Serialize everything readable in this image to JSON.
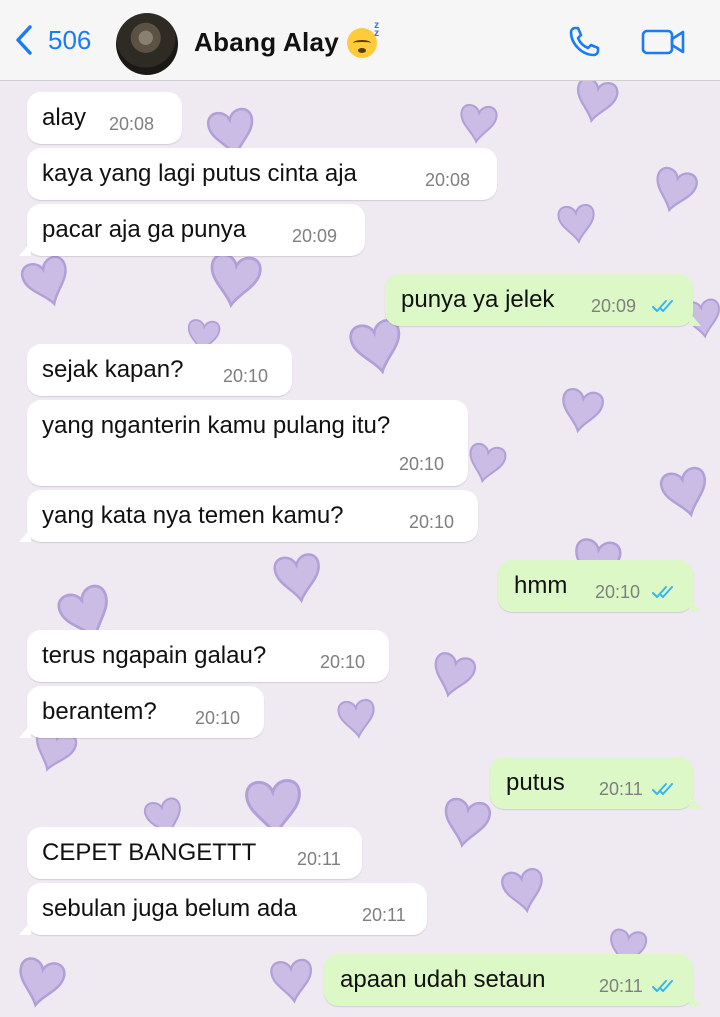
{
  "header": {
    "back_count": "506",
    "contact_name": "Abang Alay",
    "status_emoji": "sleeping-face",
    "call_icon": "phone-icon",
    "video_icon": "video-camera-icon"
  },
  "colors": {
    "accent": "#1a7cf4",
    "incoming_bubble": "#ffffff",
    "outgoing_bubble": "#dcf8c6",
    "read_ticks": "#34b7f1",
    "wallpaper_heart": "#b9a6dd"
  },
  "messages": [
    {
      "dir": "in",
      "text": "alay",
      "time": "20:08"
    },
    {
      "dir": "in",
      "text": "kaya yang lagi putus cinta aja",
      "time": "20:08"
    },
    {
      "dir": "in",
      "text": "pacar aja ga punya",
      "time": "20:09"
    },
    {
      "dir": "out",
      "text": "punya ya jelek",
      "time": "20:09",
      "read": true
    },
    {
      "dir": "in",
      "text": "sejak kapan?",
      "time": "20:10"
    },
    {
      "dir": "in",
      "text": "yang nganterin kamu pulang itu?",
      "time": "20:10"
    },
    {
      "dir": "in",
      "text": "yang kata nya temen kamu?",
      "time": "20:10"
    },
    {
      "dir": "out",
      "text": "hmm",
      "time": "20:10",
      "read": true
    },
    {
      "dir": "in",
      "text": "terus ngapain galau?",
      "time": "20:10"
    },
    {
      "dir": "in",
      "text": "berantem?",
      "time": "20:10"
    },
    {
      "dir": "out",
      "text": "putus",
      "time": "20:11",
      "read": true
    },
    {
      "dir": "in",
      "text": "CEPET BANGETTT",
      "time": "20:11"
    },
    {
      "dir": "in",
      "text": "sebulan juga belum ada",
      "time": "20:11"
    },
    {
      "dir": "out",
      "text": "apaan udah setaun",
      "time": "20:11",
      "read": true
    }
  ]
}
